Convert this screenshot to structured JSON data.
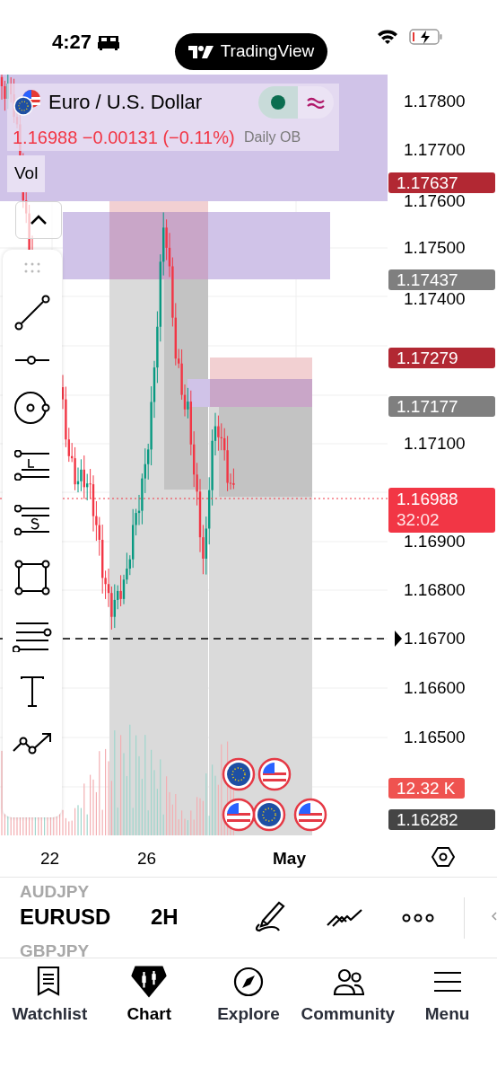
{
  "status_bar": {
    "time": "4:27"
  },
  "app_pill": {
    "label": "TradingView"
  },
  "legend": {
    "title": "Euro / U.S. Dollar",
    "quote": "1.16988 −0.00131 (−0.11%)",
    "indicator": "Vol"
  },
  "zone_label": "Daily OB",
  "price_axis": {
    "labels": [
      "1.17800",
      "1.17700",
      "1.17600",
      "1.17500",
      "1.17400",
      "1.17100",
      "1.16900",
      "1.16800",
      "1.16700",
      "1.16600",
      "1.16500"
    ]
  },
  "price_badges": [
    {
      "text": "1.17637",
      "color": "#b22833"
    },
    {
      "text": "1.17437",
      "color": "#7f7f7f"
    },
    {
      "text": "1.17279",
      "color": "#b22833"
    },
    {
      "text": "1.17177",
      "color": "#7f7f7f"
    },
    {
      "text": "1.16988",
      "countdown": "32:02",
      "color": "#f23645"
    },
    {
      "text": "12.32 K",
      "color": "#ef5350"
    },
    {
      "text": "1.16282",
      "color": "#454545"
    }
  ],
  "time_axis": [
    {
      "label": "22",
      "kind": "day"
    },
    {
      "label": "26",
      "kind": "day"
    },
    {
      "label": "May",
      "kind": "month"
    }
  ],
  "symbol_bar": {
    "previous": "AUDJPY",
    "symbol": "EURUSD",
    "interval": "2H",
    "next": "GBPJPY"
  },
  "tabs": [
    {
      "label": "Watchlist",
      "selected": false
    },
    {
      "label": "Chart",
      "selected": true
    },
    {
      "label": "Explore",
      "selected": false
    },
    {
      "label": "Community",
      "selected": false
    },
    {
      "label": "Menu",
      "selected": false
    }
  ]
}
